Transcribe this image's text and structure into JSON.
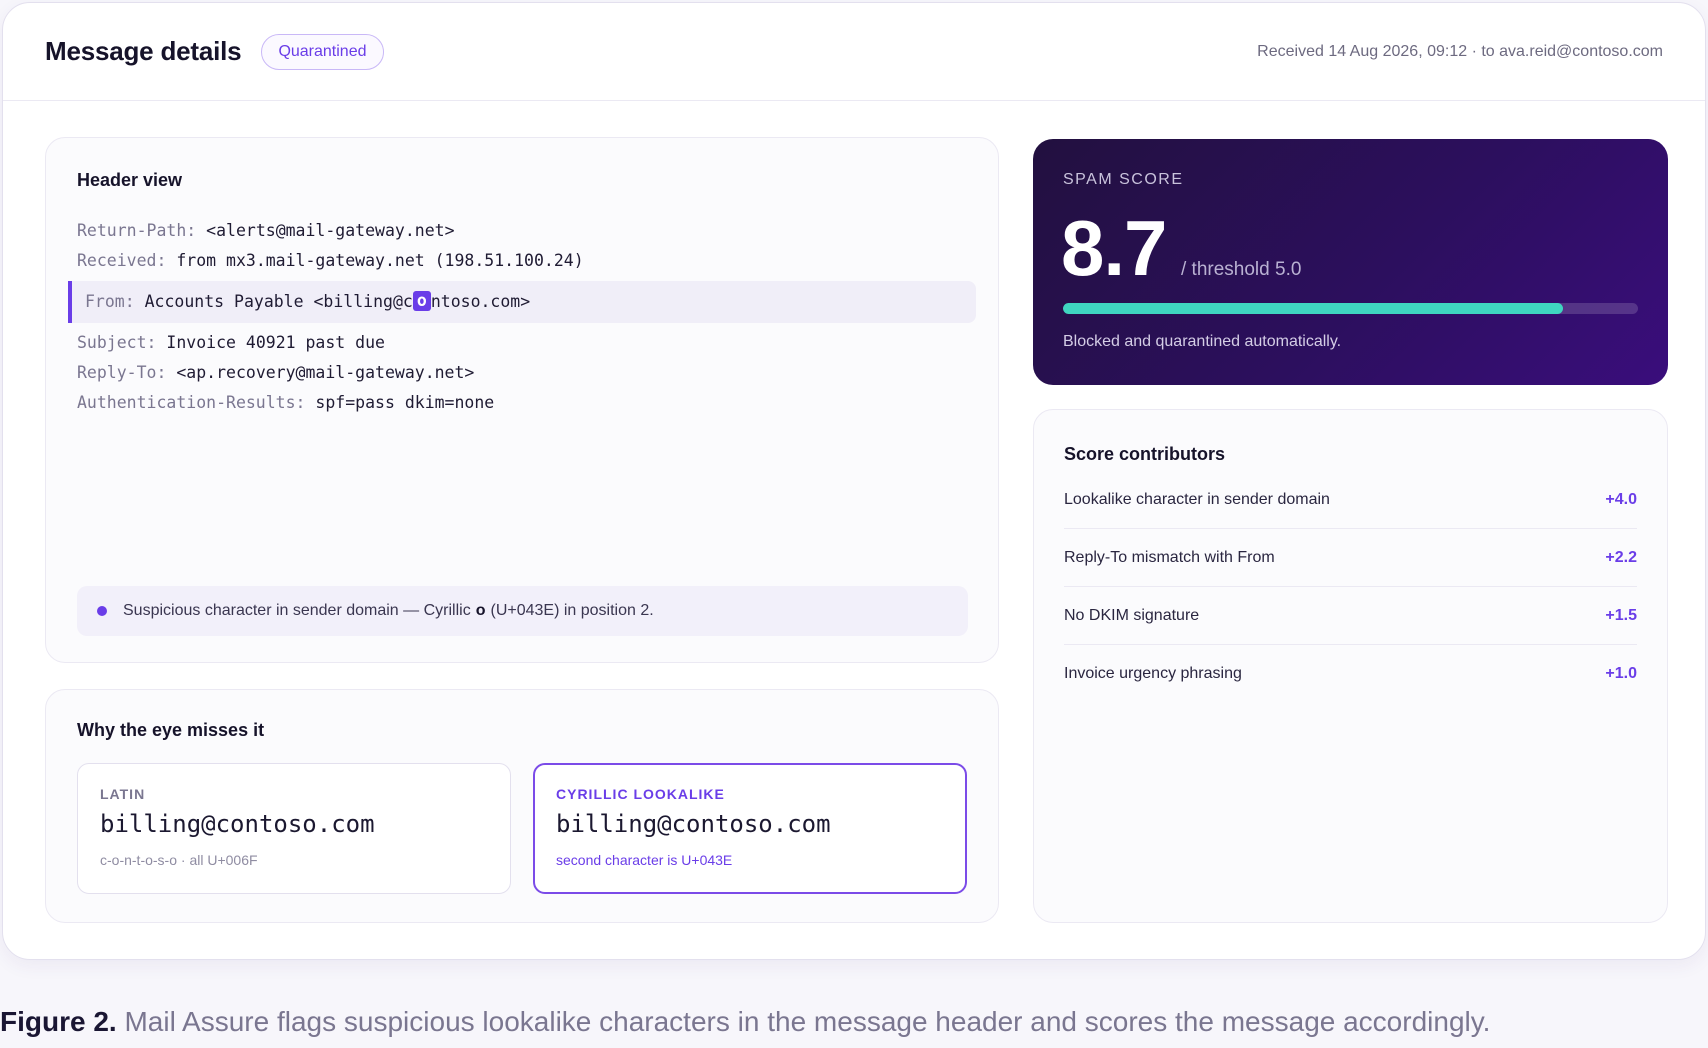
{
  "header": {
    "title": "Message details",
    "status_badge": "Quarantined",
    "received": "Received 14 Aug 2026, 09:12 · to ava.reid@contoso.com"
  },
  "header_view": {
    "title": "Header view",
    "lines": [
      {
        "key": "Return-Path:",
        "value": "<alerts@mail-gateway.net>"
      },
      {
        "key": "Received:",
        "value": "from mx3.mail-gateway.net (198.51.100.24)"
      },
      {
        "key": "From:",
        "value_before": "Accounts Payable <billing@c",
        "highlight_char": "o",
        "value_after": "ntoso.com>"
      },
      {
        "key": "Subject:",
        "value": "Invoice 40921 past due"
      },
      {
        "key": "Reply-To:",
        "value": "<ap.recovery@mail-gateway.net>"
      },
      {
        "key": "Authentication-Results:",
        "value": "spf=pass dkim=none"
      }
    ],
    "alert": {
      "before": "Suspicious character in sender domain — Cyrillic",
      "char": "о",
      "after": "(U+043E) in position 2."
    }
  },
  "why": {
    "title": "Why the eye misses it",
    "latin": {
      "label": "LATIN",
      "address": "billing@contoso.com",
      "note": "c-o-n-t-o-s-o · all U+006F"
    },
    "cyrillic": {
      "label": "CYRILLIC LOOKALIKE",
      "address": "billing@cоntoso.com",
      "note": "second character is U+043E"
    }
  },
  "spam_score": {
    "label": "SPAM SCORE",
    "value": "8.7",
    "threshold": "/ threshold 5.0",
    "fill_fraction": 0.87,
    "note": "Blocked and quarantined automatically.",
    "bar_color": "#3fd6c0"
  },
  "contributors": {
    "title": "Score contributors",
    "items": [
      {
        "label": "Lookalike character in sender domain",
        "points": "+4.0"
      },
      {
        "label": "Reply-To mismatch with From",
        "points": "+2.2"
      },
      {
        "label": "No DKIM signature",
        "points": "+1.5"
      },
      {
        "label": "Invoice urgency phrasing",
        "points": "+1.0"
      }
    ]
  },
  "caption": {
    "label": "Figure 2.",
    "text": "Mail Assure flags suspicious lookalike characters in the message header and scores the message accordingly."
  },
  "colors": {
    "accent": "#6a3de8",
    "score_bg": "#2c0f5e"
  }
}
